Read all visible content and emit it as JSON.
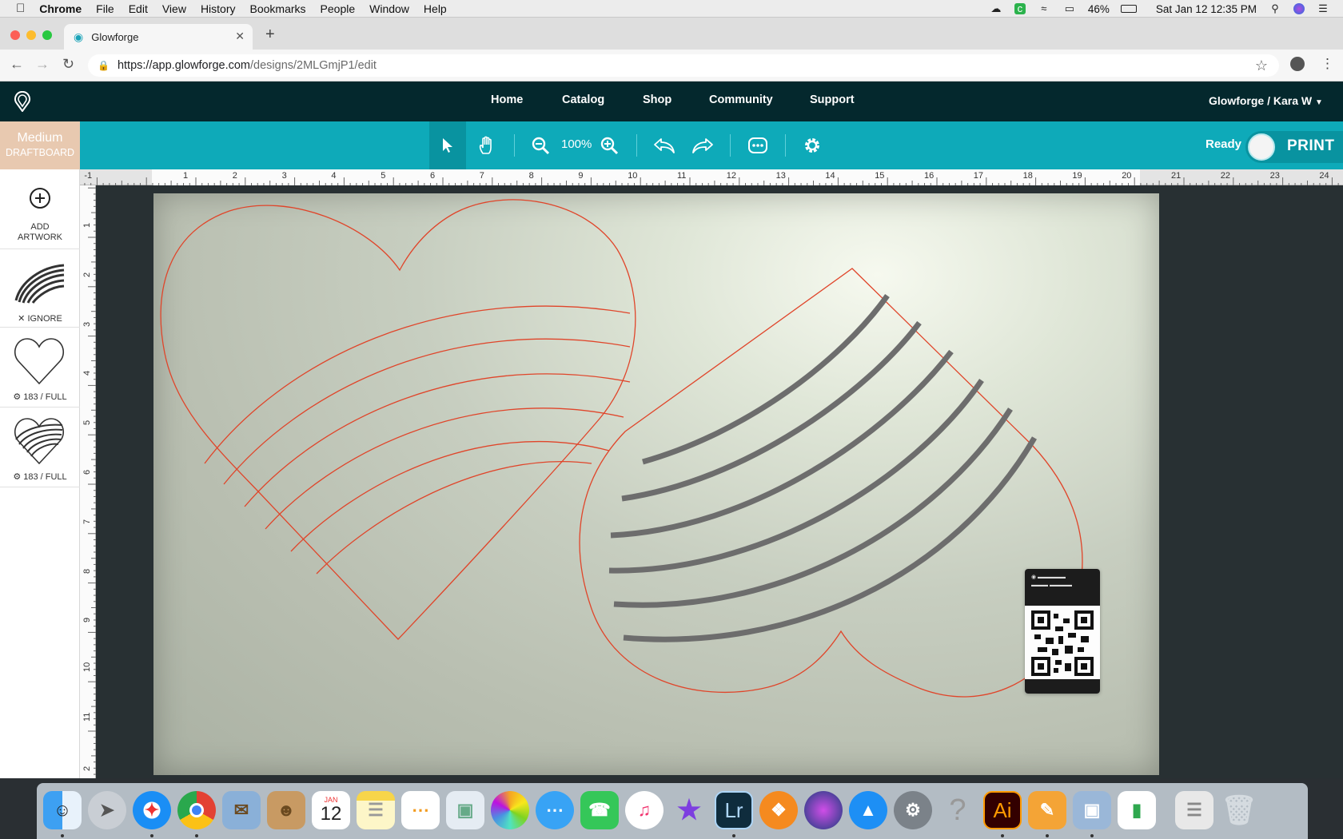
{
  "menubar": {
    "app": "Chrome",
    "items": [
      "File",
      "Edit",
      "View",
      "History",
      "Bookmarks",
      "People",
      "Window",
      "Help"
    ],
    "status": {
      "battery": "46%",
      "datetime": "Sat Jan 12  12:35 PM"
    }
  },
  "browser": {
    "tab_title": "Glowforge",
    "url_host": "https://app.glowforge.com",
    "url_path": "/designs/2MLGmjP1/edit"
  },
  "header": {
    "nav": [
      "Home",
      "Catalog",
      "Shop",
      "Community",
      "Support"
    ],
    "user": "Glowforge  /  Kara W"
  },
  "toolbar": {
    "material_line1": "Medium",
    "material_line2": "DRAFTBOARD",
    "zoom": "100%",
    "status": "Ready",
    "print_label": "PRINT"
  },
  "sidebar": {
    "add_line1": "ADD",
    "add_line2": "ARTWORK",
    "item1_label": "IGNORE",
    "item2_label": "183 / FULL",
    "item3_label": "183 / FULL"
  },
  "ruler": {
    "h": [
      "-1",
      "1",
      "2",
      "3",
      "4",
      "5",
      "6",
      "7",
      "8",
      "9",
      "10",
      "11",
      "12",
      "13",
      "14",
      "15",
      "16",
      "17",
      "18",
      "19",
      "20",
      "21",
      "22",
      "23",
      "24"
    ],
    "v": [
      "1",
      "2",
      "3",
      "4",
      "5",
      "6",
      "7",
      "8",
      "9",
      "10",
      "11",
      "2"
    ]
  },
  "colors": {
    "header": "#04282d",
    "toolbar": "#0eaab9",
    "cut_line": "#e0452a",
    "engrave": "#6d6d6d"
  },
  "dock": {
    "calendar_month": "JAN",
    "calendar_day": "12",
    "lightroom": "Lr",
    "illustrator": "Ai"
  }
}
